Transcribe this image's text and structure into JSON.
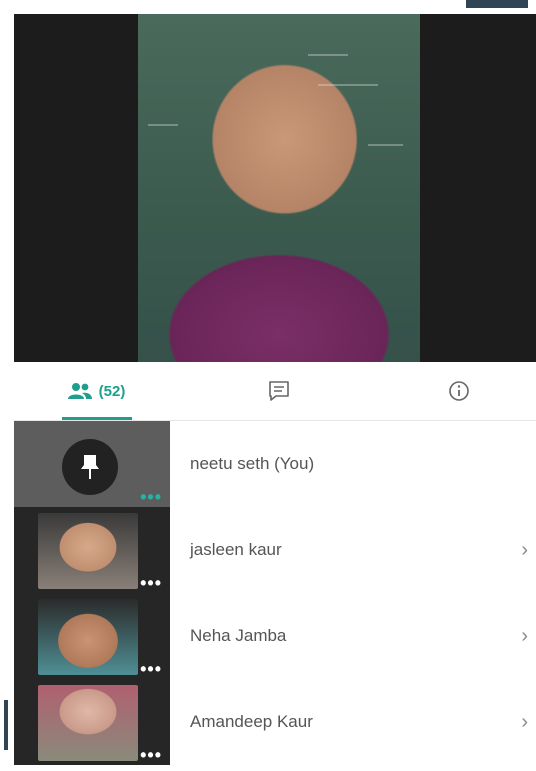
{
  "tabs": {
    "participants_count": "(52)",
    "participants_icon": "people-icon",
    "chat_icon": "chat-icon",
    "info_icon": "info-icon",
    "accent": "#1f9e8e"
  },
  "participants": [
    {
      "name": "neetu seth (You)",
      "pinned_icon": "pin-icon"
    },
    {
      "name": "jasleen kaur"
    },
    {
      "name": "Neha Jamba"
    },
    {
      "name": "Amandeep Kaur"
    }
  ]
}
